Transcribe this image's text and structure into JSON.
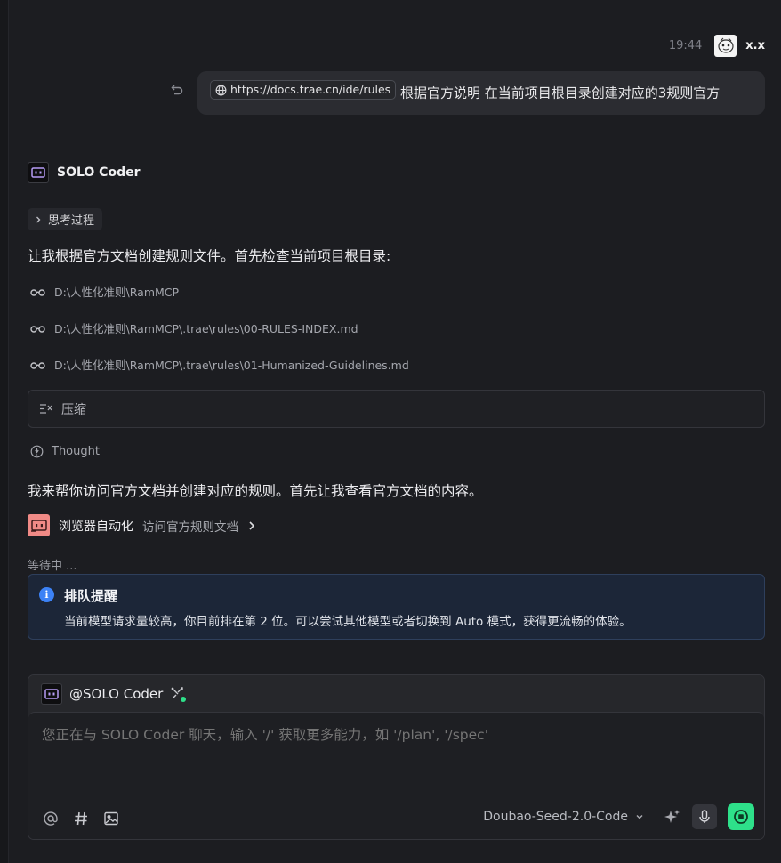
{
  "user_message": {
    "time": "19:44",
    "user_name": "x.x",
    "url_chip": "https://docs.trae.cn/ide/rules",
    "text": "根据官方说明 在当前项目根目录创建对应的3规则官方"
  },
  "agent": {
    "name": "SOLO Coder",
    "thinking_label": "思考过程",
    "intro_text": "让我根据官方文档创建规则文件。首先检查当前项目根目录:",
    "files": [
      "D:\\人性化准则\\RamMCP",
      "D:\\人性化准则\\RamMCP\\.trae\\rules\\00-RULES-INDEX.md",
      "D:\\人性化准则\\RamMCP\\.trae\\rules\\01-Humanized-Guidelines.md"
    ],
    "compress_label": "压缩",
    "thought_label": "Thought",
    "followup_text": "我来帮你访问官方文档并创建对应的规则。首先让我查看官方文档的内容。",
    "tool": {
      "name": "浏览器自动化",
      "description": "访问官方规则文档"
    },
    "waiting_text": "等待中 ...",
    "queue": {
      "title": "排队提醒",
      "text": "当前模型请求量较高，你目前排在第 2 位。可以尝试其他模型或者切换到 Auto 模式，获得更流畅的体验。"
    }
  },
  "composer": {
    "mention": "@SOLO Coder",
    "placeholder": "您正在与 SOLO Coder 聊天，输入 '/' 获取更多能力，如 '/plan', '/spec'",
    "model": "Doubao-Seed-2.0-Code"
  },
  "colors": {
    "background": "#1c1d21",
    "accent_green": "#2ee08a",
    "info_blue": "#3c82f6",
    "tool_icon": "#f08a86"
  }
}
